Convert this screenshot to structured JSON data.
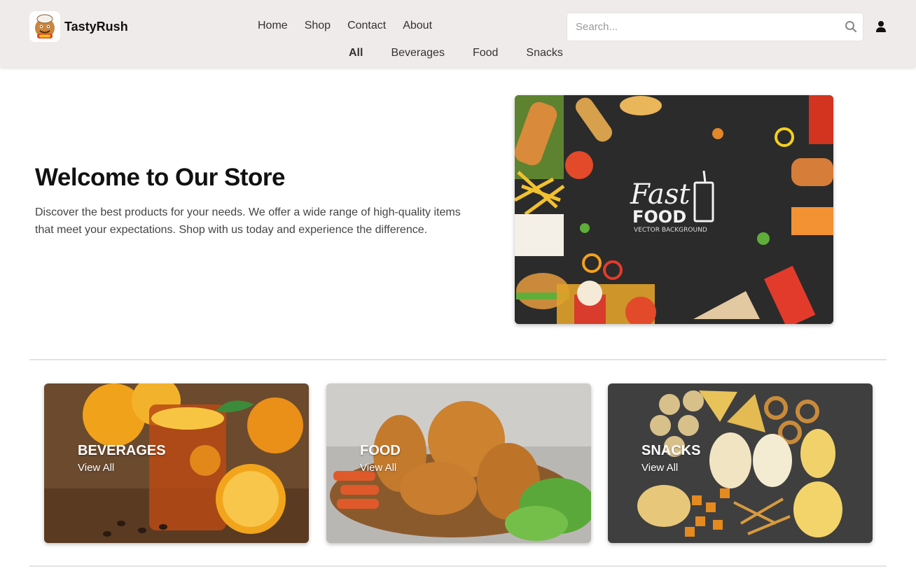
{
  "brand": {
    "name": "TastyRush",
    "logo_icon": "chef-mascot-icon"
  },
  "nav": {
    "items": [
      {
        "label": "Home"
      },
      {
        "label": "Shop"
      },
      {
        "label": "Contact"
      },
      {
        "label": "About"
      }
    ]
  },
  "categories_nav": {
    "items": [
      {
        "label": "All",
        "active": true
      },
      {
        "label": "Beverages",
        "active": false
      },
      {
        "label": "Food",
        "active": false
      },
      {
        "label": "Snacks",
        "active": false
      }
    ]
  },
  "search": {
    "placeholder": "Search...",
    "value": "",
    "icon": "search-icon"
  },
  "user": {
    "icon": "user-icon"
  },
  "hero": {
    "title": "Welcome to Our Store",
    "text": "Discover the best products for your needs. We offer a wide range of high-quality items that meet your expectations. Shop with us today and experience the difference.",
    "image_title_script": "Fast",
    "image_title_bold": "FOOD",
    "image_caption": "VECTOR BACKGROUND"
  },
  "cards": [
    {
      "title": "BEVERAGES",
      "link": "View All"
    },
    {
      "title": "FOOD",
      "link": "View All"
    },
    {
      "title": "SNACKS",
      "link": "View All"
    }
  ],
  "colors": {
    "header_bg": "#efebea",
    "text_dark": "#111111",
    "text_body": "#444444",
    "divider": "#e3e3e3"
  }
}
